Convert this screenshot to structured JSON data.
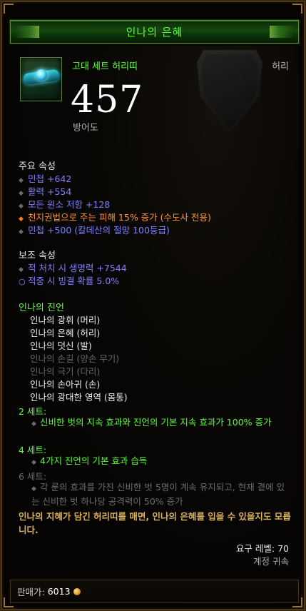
{
  "item": {
    "name": "인나의 은혜",
    "type": "고대 세트 허리띠",
    "slot": "허리",
    "armor": "457",
    "armor_label": "방어도"
  },
  "primary": {
    "title": "주요 속성",
    "stats": [
      "민첩 +642",
      "활력 +554",
      "모든 원소 저항 +128",
      "천지권법으로 주는 피해 15% 증가 (수도사 전용)",
      "민첩 +500 (칼데산의 절망 100등급)"
    ]
  },
  "secondary": {
    "title": "보조 속성",
    "stats": [
      "적 처치 시 생명력 +7544",
      "적중 시 빙결 확률 5.0%"
    ]
  },
  "set": {
    "name": "인나의 진언",
    "items": [
      "인나의 광휘 (머리)",
      "인나의 은혜 (허리)",
      "인나의 덧신 (발)",
      "인나의 손길 (양손 무기)",
      "인나의 극기 (다리)",
      "인나의 손아귀 (손)",
      "인나의 광대한 영역 (몸통)"
    ],
    "bonus_2_label": "2 세트:",
    "bonus_2_text": "신비한 벗의 지속 효과와 진언의 기본 지속 효과가 100% 증가",
    "bonus_4_label": "4 세트:",
    "bonus_4_text": "4가지 진언의 기본 효과 습득",
    "bonus_6_label": "6 세트:",
    "bonus_6_text": "각 룬의 효과를 가진 신비한 벗 5명이 계속 유지되고, 현재 곁에 있는 신비한 벗 하나당 공격력이 50% 증가"
  },
  "flavor": "인나의 지혜가 담긴 허리띠를 매면, 인나의 은혜를 입을 수 있을지도 모릅니다.",
  "requirement": "요구 레벨: 70",
  "binding": "계정 귀속",
  "sell": {
    "label": "판매가:",
    "value": "6013"
  },
  "colors": {
    "set_green": "#5cff3a",
    "magic_blue": "#7f7fff",
    "legendary_orange": "#ff9430",
    "flavor_gold": "#d9b05c"
  }
}
